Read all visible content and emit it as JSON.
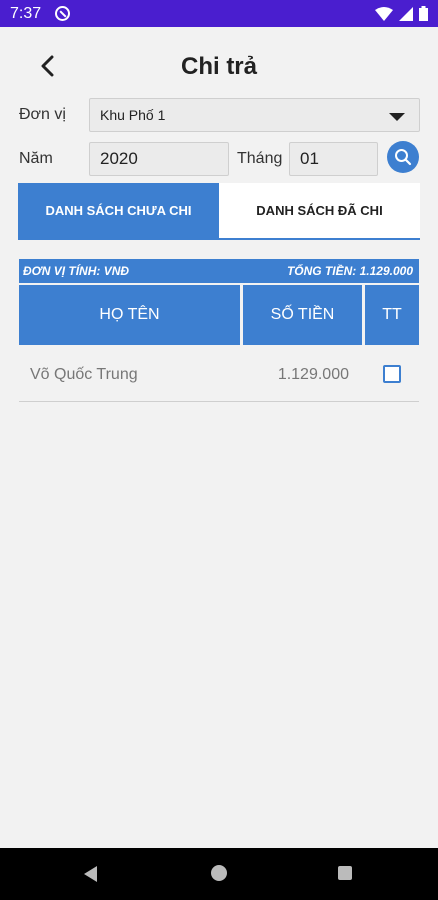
{
  "status_bar": {
    "time": "7:37"
  },
  "header": {
    "title": "Chi trả"
  },
  "filters": {
    "unit_label": "Đơn vị",
    "unit_value": "Khu Phố 1",
    "year_label": "Năm",
    "year_value": "2020",
    "month_label": "Tháng",
    "month_value": "01"
  },
  "tabs": [
    {
      "label": "DANH SÁCH CHƯA CHI",
      "active": true
    },
    {
      "label": "DANH SÁCH ĐÃ CHI",
      "active": false
    }
  ],
  "summary": {
    "unit_note": "ĐƠN VỊ TÍNH: VNĐ",
    "total_label": "TỔNG TIỀN:",
    "total_value": "1.129.000"
  },
  "table": {
    "columns": [
      "HỌ TÊN",
      "SỐ TIỀN",
      "TT"
    ],
    "rows": [
      {
        "name": "Võ Quốc Trung",
        "amount": "1.129.000",
        "checked": false
      }
    ]
  },
  "colors": {
    "accent": "#3d7fd0",
    "status_bar": "#4a1ecf"
  }
}
